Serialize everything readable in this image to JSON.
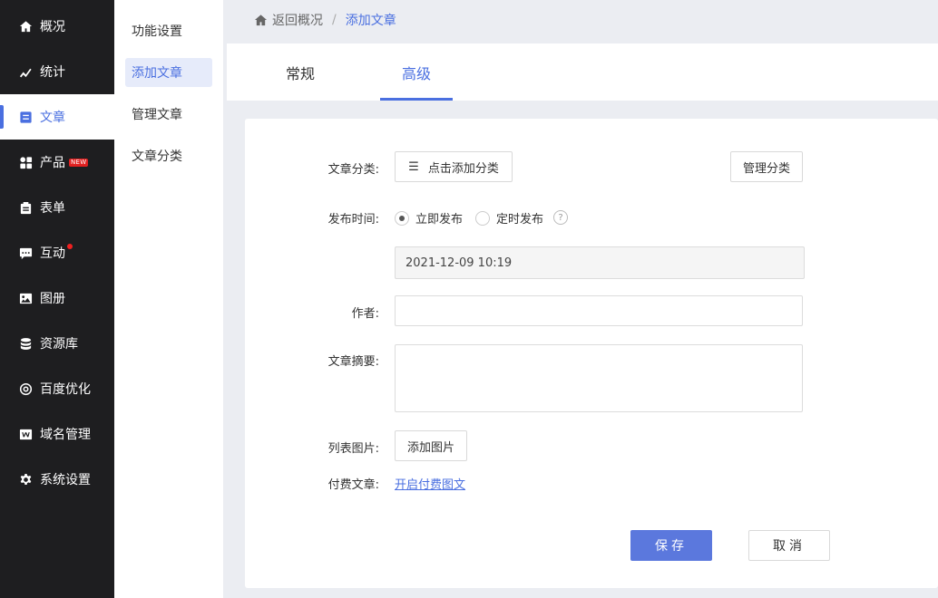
{
  "sidebar": {
    "items": [
      {
        "label": "概况",
        "icon": "home-icon"
      },
      {
        "label": "统计",
        "icon": "chart-icon"
      },
      {
        "label": "文章",
        "icon": "article-icon"
      },
      {
        "label": "产品",
        "icon": "grid-icon",
        "badge": "NEW"
      },
      {
        "label": "表单",
        "icon": "clipboard-icon"
      },
      {
        "label": "互动",
        "icon": "chat-icon"
      },
      {
        "label": "图册",
        "icon": "image-icon"
      },
      {
        "label": "资源库",
        "icon": "database-icon"
      },
      {
        "label": "百度优化",
        "icon": "target-icon"
      },
      {
        "label": "域名管理",
        "icon": "domain-icon"
      },
      {
        "label": "系统设置",
        "icon": "gear-icon"
      }
    ]
  },
  "subnav": {
    "items": [
      {
        "label": "功能设置"
      },
      {
        "label": "添加文章"
      },
      {
        "label": "管理文章"
      },
      {
        "label": "文章分类"
      }
    ]
  },
  "breadcrumb": {
    "back": "返回概况",
    "separator": "/",
    "current": "添加文章"
  },
  "tabs": [
    {
      "label": "常规"
    },
    {
      "label": "高级"
    }
  ],
  "form": {
    "category_label": "文章分类:",
    "add_category": "点击添加分类",
    "manage_category": "管理分类",
    "publish_label": "发布时间:",
    "publish_now": "立即发布",
    "publish_scheduled": "定时发布",
    "help": "?",
    "datetime": "2021-12-09 10:19",
    "author_label": "作者:",
    "summary_label": "文章摘要:",
    "list_image_label": "列表图片:",
    "add_image": "添加图片",
    "paid_label": "付费文章:",
    "paid_link": "开启付费图文",
    "save": "保存",
    "cancel": "取消"
  },
  "colors": {
    "accent": "#4a6fe0",
    "sidebar_bg": "#1e1e20",
    "badge": "#e02020"
  }
}
